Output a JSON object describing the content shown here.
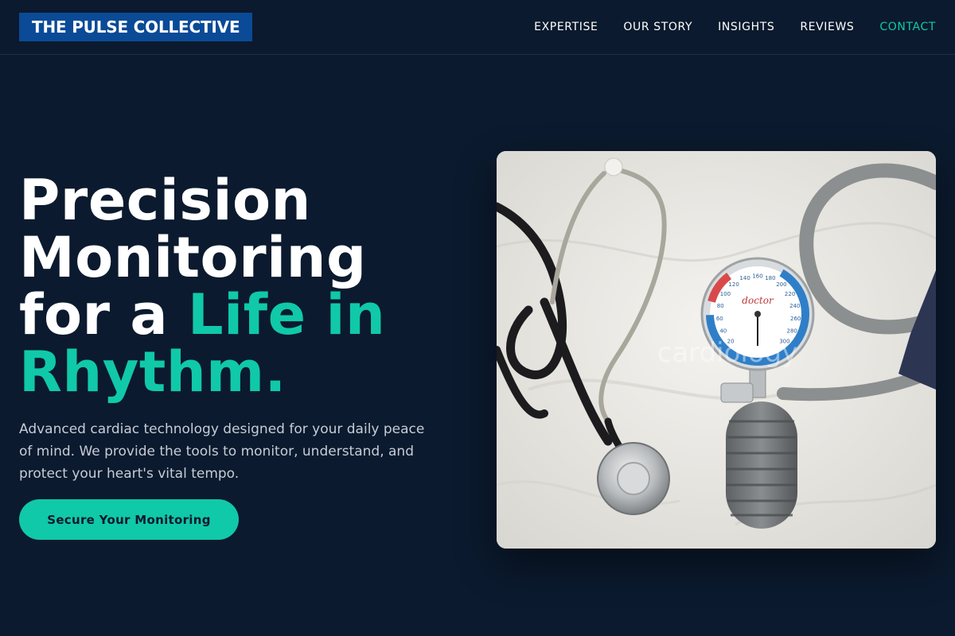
{
  "header": {
    "logo_text": "THE PULSE COLLECTIVE",
    "nav": [
      {
        "label": "EXPERTISE"
      },
      {
        "label": "OUR STORY"
      },
      {
        "label": "INSIGHTS"
      },
      {
        "label": "REVIEWS"
      },
      {
        "label": "CONTACT",
        "active": true
      }
    ]
  },
  "hero": {
    "title_line1": "Precision",
    "title_line2": "Monitoring",
    "title_line3_a": "for a ",
    "title_line3_b": "Life in",
    "title_line4": "Rhythm.",
    "subtitle": "Advanced cardiac technology designed for your daily peace of mind. We provide the tools to monitor, understand, and protect your heart's vital tempo.",
    "cta_label": "Secure Your Monitoring"
  },
  "image": {
    "gauge_brand": "doctor",
    "watermark": "cardiology",
    "gauge_scale": [
      "20",
      "40",
      "60",
      "80",
      "100",
      "120",
      "140",
      "160",
      "180",
      "200",
      "220",
      "240",
      "260",
      "280",
      "300"
    ]
  },
  "colors": {
    "background": "#0b1a2e",
    "accent": "#10c9a9",
    "logo_bg": "#0a4a96",
    "text_muted": "#c6ccd6"
  }
}
